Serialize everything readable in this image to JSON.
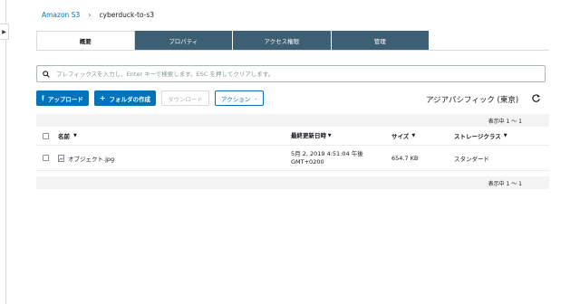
{
  "breadcrumb": {
    "root": "Amazon S3",
    "separator": "›",
    "bucket": "cyberduck-to-s3"
  },
  "tabs": [
    {
      "label": "概要",
      "active": true
    },
    {
      "label": "プロパティ",
      "active": false
    },
    {
      "label": "アクセス権限",
      "active": false
    },
    {
      "label": "管理",
      "active": false
    }
  ],
  "search": {
    "placeholder": "プレフィックスを入力し、Enter キーで検索します。ESC を押してクリアします。",
    "value": ""
  },
  "toolbar": {
    "upload_label": "アップロード",
    "create_folder_label": "フォルダの作成",
    "download_label": "ダウンロード",
    "actions_label": "アクション"
  },
  "region": "アジアパシフィック (東京)",
  "table": {
    "count_top": "表示中 1 〜 1",
    "count_bottom": "表示中 1 〜 1",
    "columns": {
      "name": "名前",
      "modified": "最終更新日時",
      "size": "サイズ",
      "storage_class": "ストレージクラス"
    },
    "rows": [
      {
        "name": "オブジェクト.jpg",
        "modified_line1": "5月 2, 2019 4:51:04 午後",
        "modified_line2": "GMT+0200",
        "size": "654.7 KB",
        "storage_class": "スタンダード"
      }
    ]
  },
  "colors": {
    "primary": "#0073bb",
    "tab_bg": "#3d5f73",
    "bar_bg": "#f2f3f3"
  }
}
